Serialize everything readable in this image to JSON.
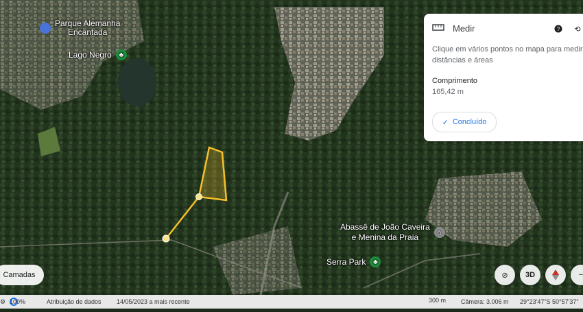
{
  "map": {
    "pois": [
      {
        "label": "Parque Alemanha",
        "label2": "Encantada",
        "icon": "blue-pin-icon",
        "color": "#4a73d9"
      },
      {
        "label": "Lago Negro",
        "icon": "park-pin-icon",
        "color": "#1e8e3e"
      },
      {
        "label": "Abassê de João Caveira",
        "label2": "e Menina da Praia",
        "icon": "worship-pin-icon",
        "color": "#8a8a8a"
      },
      {
        "label": "Serra Park",
        "icon": "park-pin-icon",
        "color": "#1e8e3e"
      }
    ],
    "measure_color": "#f6c02b"
  },
  "measure_panel": {
    "title": "Medir",
    "description": "Clique em vários pontos no mapa para medir distâncias e áreas",
    "length_label": "Comprimento",
    "length_value": "165,42 m",
    "done_label": "Concluído"
  },
  "controls": {
    "layers_label": "Camadas",
    "btn_3d": "3D"
  },
  "statusbar": {
    "zoom": "100%",
    "attribution": "Atribuição de dados",
    "date": "14/05/2023 a mais recente",
    "scale": "300 m",
    "camera": "Câmera: 3.006 m",
    "coords": "29°23'47\"S 50°57'37\""
  }
}
